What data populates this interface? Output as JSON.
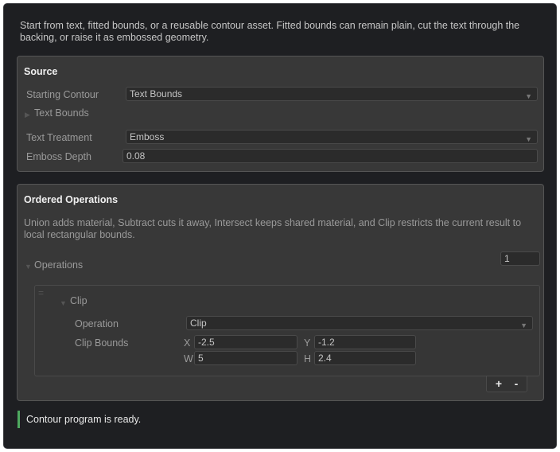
{
  "intro_text": "Start from text, fitted bounds, or a reusable contour asset. Fitted bounds can remain plain, cut the text through the backing, or raise it as embossed geometry.",
  "source": {
    "title": "Source",
    "starting_contour_label": "Starting Contour",
    "starting_contour_value": "Text Bounds",
    "text_bounds_label": "Text Bounds",
    "text_treatment_label": "Text Treatment",
    "text_treatment_value": "Emboss",
    "emboss_depth_label": "Emboss Depth",
    "emboss_depth_value": "0.08"
  },
  "operations": {
    "title": "Ordered Operations",
    "description": "Union adds material, Subtract cuts it away, Intersect keeps shared material, and Clip restricts the current result to local rectangular bounds.",
    "list_label": "Operations",
    "count": "1",
    "items": [
      {
        "name": "Clip",
        "operation_label": "Operation",
        "operation_value": "Clip",
        "clip_bounds_label": "Clip Bounds",
        "x_label": "X",
        "x_value": "-2.5",
        "y_label": "Y",
        "y_value": "-1.2",
        "w_label": "W",
        "w_value": "5",
        "h_label": "H",
        "h_value": "2.4"
      }
    ],
    "add_label": "+",
    "remove_label": "-"
  },
  "status_text": "Contour program is ready.",
  "colors": {
    "status_accent": "#4ea95f",
    "panel_bg": "#383838",
    "window_bg": "#1e1f22"
  }
}
